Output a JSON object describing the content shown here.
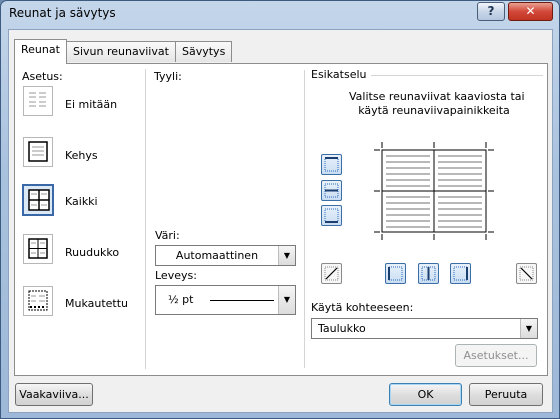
{
  "window": {
    "title": "Reunat ja sävytys",
    "help": "?",
    "close": "✕"
  },
  "tabs": [
    {
      "label": "Reunat",
      "active": true
    },
    {
      "label": "Sivun reunaviivat",
      "active": false
    },
    {
      "label": "Sävytys",
      "active": false
    }
  ],
  "setting": {
    "label": "Asetus:",
    "options": [
      {
        "label": "Ei mitään",
        "selected": false
      },
      {
        "label": "Kehys",
        "selected": false
      },
      {
        "label": "Kaikki",
        "selected": true
      },
      {
        "label": "Ruudukko",
        "selected": false
      },
      {
        "label": "Mukautettu",
        "selected": false
      }
    ]
  },
  "style": {
    "label": "Tyyli:"
  },
  "color": {
    "label": "Väri:",
    "value": "Automaattinen"
  },
  "width": {
    "label": "Leveys:",
    "value": "½ pt"
  },
  "preview": {
    "label": "Esikatselu",
    "instructions_line1": "Valitse reunaviivat kaaviosta tai",
    "instructions_line2": "käytä reunaviivapainikkeita"
  },
  "apply_to": {
    "label": "Käytä kohteeseen:",
    "value": "Taulukko"
  },
  "buttons": {
    "options": "Asetukset...",
    "horizontal_line": "Vaakaviiva...",
    "ok": "OK",
    "cancel": "Peruuta"
  },
  "colors": {
    "accent": "#3a68a6",
    "panel_bg": "#ffffff",
    "dialog_bg": "#f0f0f0"
  }
}
